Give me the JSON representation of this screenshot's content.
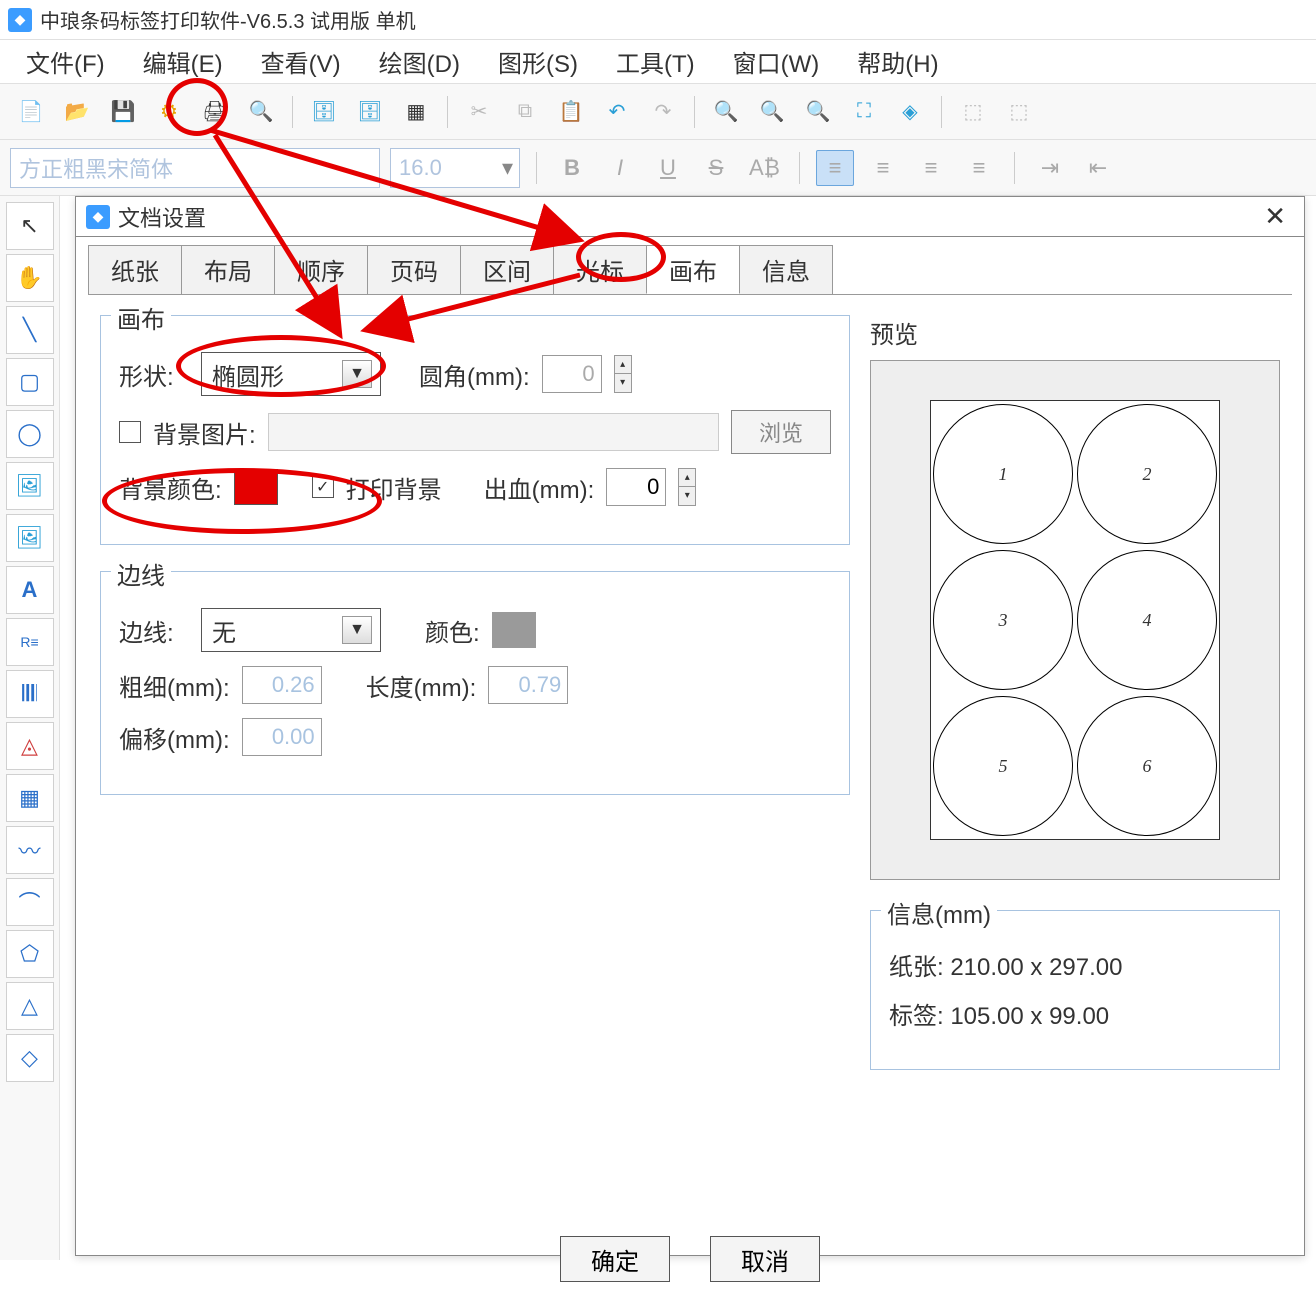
{
  "titlebar": {
    "title": "中琅条码标签打印软件-V6.5.3 试用版 单机"
  },
  "menu": {
    "file": "文件(F)",
    "edit": "编辑(E)",
    "view": "查看(V)",
    "draw": "绘图(D)",
    "shape": "图形(S)",
    "tool": "工具(T)",
    "window": "窗口(W)",
    "help": "帮助(H)"
  },
  "format": {
    "font": "方正粗黑宋简体",
    "size": "16.0"
  },
  "dialog": {
    "title": "文档设置",
    "tabs": {
      "paper": "纸张",
      "layout": "布局",
      "order": "顺序",
      "page": "页码",
      "range": "区间",
      "cursor": "光标",
      "canvas": "画布",
      "info": "信息"
    },
    "canvas_group": "画布",
    "shape_lbl": "形状:",
    "shape_val": "椭圆形",
    "corner_lbl": "圆角(mm):",
    "corner_val": "0",
    "bg_img_lbl": "背景图片:",
    "browse": "浏览",
    "bg_color_lbl": "背景颜色:",
    "bg_color": "#e40000",
    "print_bg_lbl": "打印背景",
    "bleed_lbl": "出血(mm):",
    "bleed_val": "0",
    "edge_group": "边线",
    "edge_lbl": "边线:",
    "edge_val": "无",
    "edge_color_lbl": "颜色:",
    "edge_color": "#9a9a9a",
    "thick_lbl": "粗细(mm):",
    "thick_val": "0.26",
    "len_lbl": "长度(mm):",
    "len_val": "0.79",
    "offset_lbl": "偏移(mm):",
    "offset_val": "0.00",
    "preview_lbl": "预览",
    "info_lbl": "信息(mm)",
    "info_paper": "纸张:  210.00 x 297.00",
    "info_label": "标签:  105.00 x 99.00",
    "ok": "确定",
    "cancel": "取消",
    "circles": [
      "1",
      "2",
      "3",
      "4",
      "5",
      "6"
    ]
  }
}
